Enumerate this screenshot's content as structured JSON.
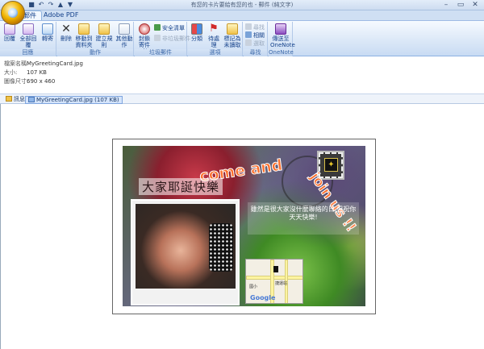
{
  "window": {
    "title": "有您的卡片要給有您的也 - 郵件 (純文字)",
    "min": "–",
    "max": "▭",
    "close": "✕"
  },
  "tabs": [
    {
      "label": "郵件"
    },
    {
      "label": "Adobe PDF"
    }
  ],
  "ribbon": {
    "reply": "回覆",
    "reply_all": "全部回覆",
    "forward": "轉寄",
    "group_respond": "回應",
    "delete": "刪除",
    "move_to_folder_l1": "移動到",
    "move_to_folder_l2": "資料夾",
    "create_rule": "建立規則",
    "other_actions": "其他動作",
    "group_actions": "動作",
    "block_sender_l1": "封鎖",
    "block_sender_l2": "寄件者",
    "safe_list": "安全清單",
    "not_junk": "非垃圾郵件",
    "group_junk": "垃圾郵件",
    "categorize": "分類",
    "follow_up": "待處理",
    "mark_unread_l1": "標記為",
    "mark_unread_l2": "未讀取",
    "group_options": "選項",
    "find": "尋找",
    "related": "相關",
    "select": "選取",
    "group_find": "尋找",
    "onenote_l1": "傳送至",
    "onenote_l2": "OneNote",
    "group_onenote": "OneNote"
  },
  "attachment_info": {
    "name_label": "檔案名稱:",
    "name": "MyGreetingCard.jpg",
    "size_label": "大小:",
    "size": "107 KB",
    "dim_label": "圖像尺寸:",
    "dimensions": "690 x 460"
  },
  "attachment_bar": {
    "message": "訊息",
    "file": "MyGreetingCard.jpg (107 KB)"
  },
  "card": {
    "title": "大家耶誕快樂",
    "come": "come and",
    "join": "join us !!",
    "message": "雖然是很大家沒什麼聯絡的日,但祝你天天快樂!",
    "map_label1": "捷運站",
    "map_label2": "國小",
    "google": "Google"
  },
  "colors": {
    "accent_orange": "#ff6e2a",
    "ribbon_text": "#15428b"
  }
}
